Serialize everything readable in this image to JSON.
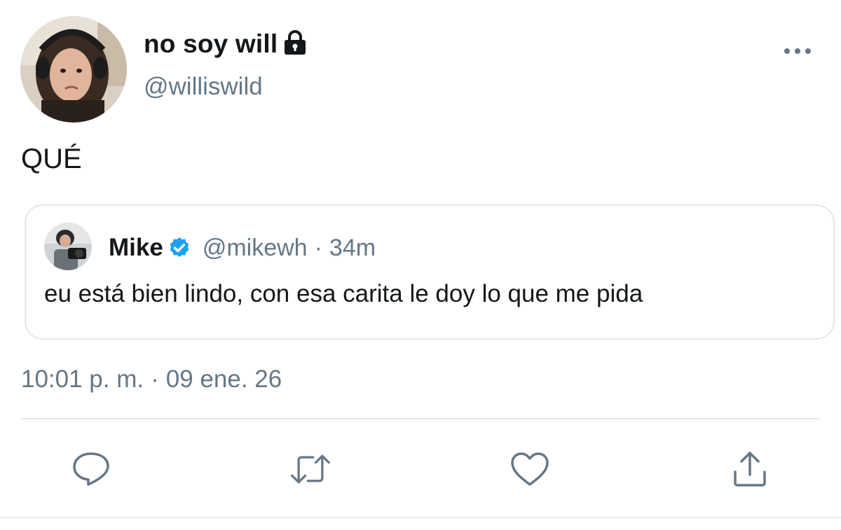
{
  "tweet": {
    "author": {
      "display_name": "no soy will",
      "handle": "@williswild",
      "protected_icon": "lock-icon"
    },
    "text": "QUÉ",
    "quoted": {
      "author_name": "Mike",
      "verified_icon": "verified-badge-icon",
      "handle": "@mikewh",
      "separator": "·",
      "relative_time": "34m",
      "text": "eu está bien lindo, con esa carita le doy lo que me pida"
    },
    "timestamp": {
      "time": "10:01 p. m.",
      "separator": "·",
      "date": "09 ene. 26"
    },
    "more_icon": "more-horizontal-icon",
    "actions": [
      {
        "name": "reply",
        "icon": "reply-icon"
      },
      {
        "name": "retweet",
        "icon": "retweet-icon"
      },
      {
        "name": "like",
        "icon": "heart-icon"
      },
      {
        "name": "share",
        "icon": "share-icon"
      }
    ],
    "colors": {
      "primary_text": "#14171a",
      "secondary_text": "#657786",
      "border": "#e1e8ed",
      "verified": "#1da1f2"
    }
  }
}
